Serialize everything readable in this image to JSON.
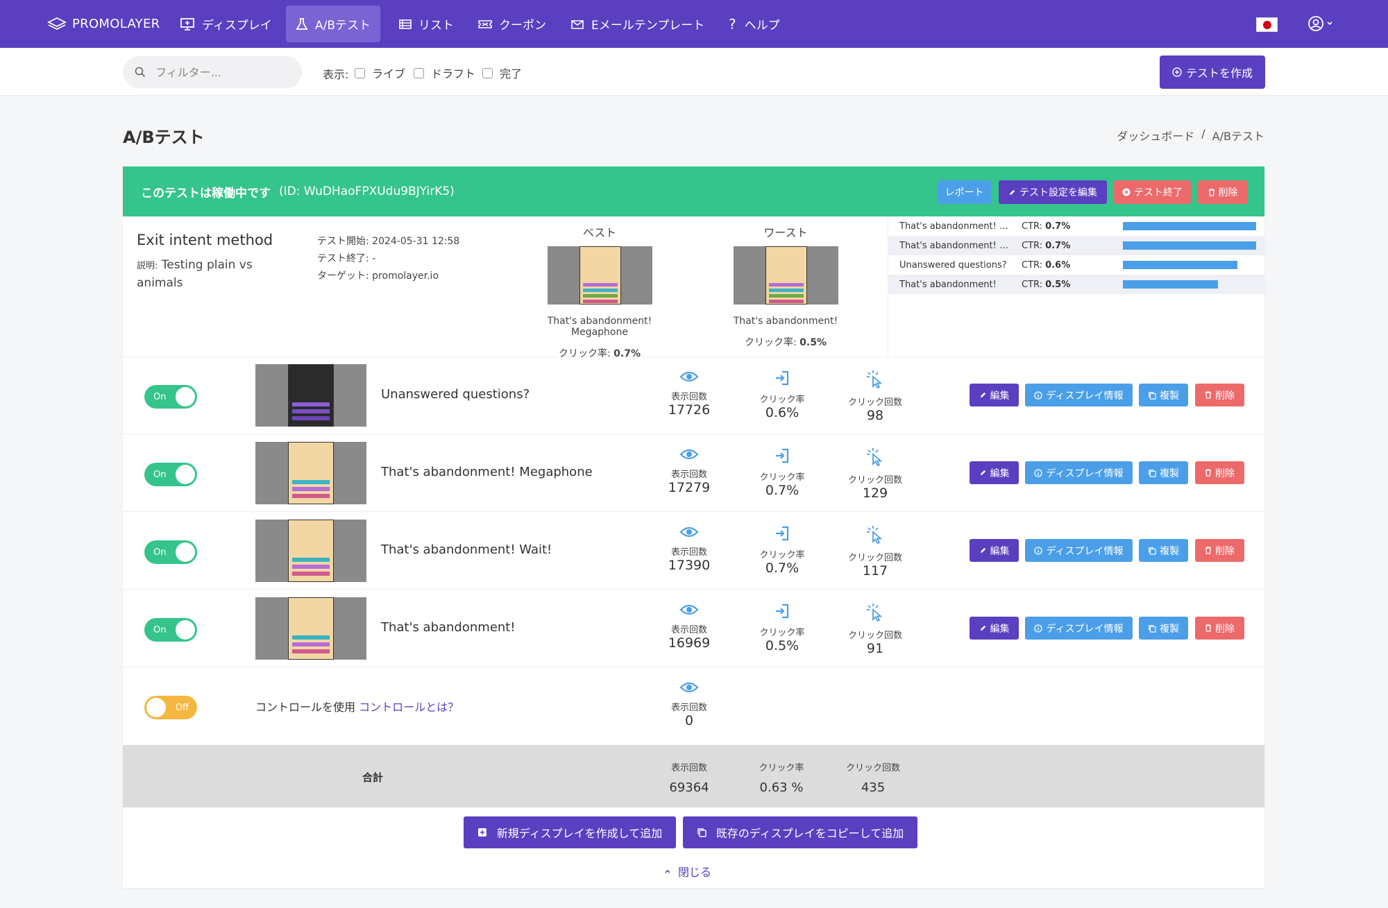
{
  "nav": {
    "brand": "PROMOLAYER",
    "items": [
      {
        "label": "ディスプレイ",
        "icon": "monitor-icon"
      },
      {
        "label": "A/Bテスト",
        "icon": "flask-icon",
        "active": true
      },
      {
        "label": "リスト",
        "icon": "list-icon"
      },
      {
        "label": "クーポン",
        "icon": "ticket-icon"
      },
      {
        "label": "Eメールテンプレート",
        "icon": "mail-icon"
      },
      {
        "label": "ヘルプ",
        "icon": "question-icon"
      }
    ]
  },
  "filter": {
    "search_placeholder": "フィルター...",
    "show_label": "表示:",
    "checks": [
      "ライブ",
      "ドラフト",
      "完了"
    ],
    "create_label": "テストを作成"
  },
  "page": {
    "title": "A/Bテスト",
    "breadcrumb": [
      "ダッシュボード",
      "/",
      "A/Bテスト"
    ]
  },
  "test": {
    "status": "このテストは稼働中です",
    "id_text": "(ID: WuDHaoFPXUdu9BJYirK5)",
    "buttons": {
      "report": "レポート",
      "edit": "テスト設定を編集",
      "end": "テスト終了",
      "delete": "削除"
    },
    "name": "Exit intent method",
    "desc_label": "説明:",
    "desc": "Testing plain vs animals",
    "meta": {
      "start": "テスト開始: 2024-05-31 12:58",
      "end": "テスト終了: -",
      "target": "ターゲット:  promolayer.io"
    },
    "best": {
      "label": "ベスト",
      "name": "That's abandonment! Megaphone",
      "ctr_label": "クリック率:",
      "ctr": "0.7%"
    },
    "worst": {
      "label": "ワースト",
      "name": "That's abandonment!",
      "ctr_label": "クリック率:",
      "ctr": "0.5%"
    },
    "ctr_list": [
      {
        "name": "That's abandonment! Megaphone",
        "ctr_label": "CTR:",
        "ctr": "0.7%",
        "value": 0.7
      },
      {
        "name": "That's abandonment! Wait!",
        "ctr_label": "CTR:",
        "ctr": "0.7%",
        "value": 0.7
      },
      {
        "name": "Unanswered questions?",
        "ctr_label": "CTR:",
        "ctr": "0.6%",
        "value": 0.6
      },
      {
        "name": "That's abandonment!",
        "ctr_label": "CTR:",
        "ctr": "0.5%",
        "value": 0.5
      }
    ]
  },
  "stat_labels": {
    "views": "表示回数",
    "ctr": "クリック率",
    "clicks": "クリック回数"
  },
  "variants": [
    {
      "toggle": "On",
      "name": "Unanswered questions?",
      "views": "17726",
      "ctr": "0.6%",
      "clicks": "98"
    },
    {
      "toggle": "On",
      "name": "That's abandonment! Megaphone",
      "views": "17279",
      "ctr": "0.7%",
      "clicks": "129"
    },
    {
      "toggle": "On",
      "name": "That's abandonment! Wait!",
      "views": "17390",
      "ctr": "0.7%",
      "clicks": "117"
    },
    {
      "toggle": "On",
      "name": "That's abandonment!",
      "views": "16969",
      "ctr": "0.5%",
      "clicks": "91"
    }
  ],
  "variant_actions": {
    "edit": "編集",
    "info": "ディスプレイ情報",
    "copy": "複製",
    "delete": "削除"
  },
  "control": {
    "toggle": "Off",
    "text": "コントロールを使用",
    "link": "コントロールとは？",
    "views": "0"
  },
  "totals": {
    "label": "合計",
    "views": "69364",
    "ctr": "0.63 %",
    "clicks": "435"
  },
  "footer": {
    "add_new": "新規ディスプレイを作成して追加",
    "add_copy": "既存のディスプレイをコピーして追加",
    "close": "閉じる"
  },
  "colors": {
    "primary": "#5a3fc0",
    "success": "#35c48b",
    "info": "#4b9fe8",
    "danger": "#ec6a6a",
    "warning": "#f4b73f"
  }
}
